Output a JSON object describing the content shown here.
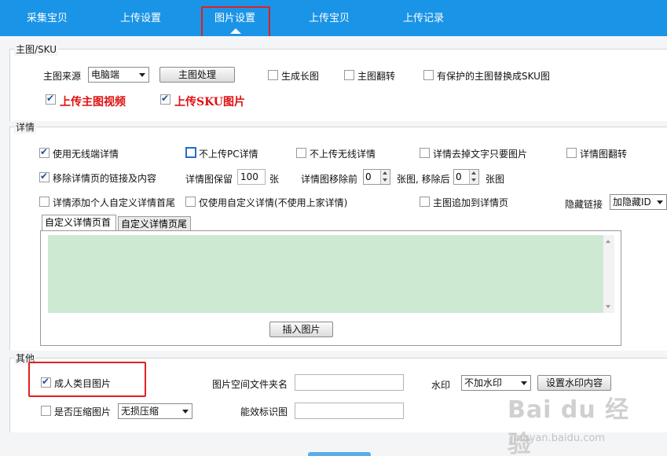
{
  "nav": {
    "tabs": [
      "采集宝贝",
      "上传设置",
      "图片设置",
      "上传宝贝",
      "上传记录"
    ],
    "active": "图片设置"
  },
  "main_image": {
    "legend": "主图/SKU",
    "source_label": "主图来源",
    "source_value": "电脑端",
    "process_button": "主图处理",
    "gen_long": "生成长图",
    "flip": "主图翻转",
    "protected": "有保护的主图替换成SKU图",
    "upload_video": "上传主图视频",
    "upload_sku": "上传SKU图片"
  },
  "detail": {
    "legend": "详情",
    "use_wireless": "使用无线端详情",
    "no_pc": "不上传PC详情",
    "no_wireless": "不上传无线详情",
    "strip_text": "详情去掉文字只要图片",
    "flip": "详情图翻转",
    "remove_links": "移除详情页的链接及内容",
    "keep_label": "详情图保留",
    "keep_value": "100",
    "keep_unit": "张",
    "remove_before_label": "详情图移除前",
    "remove_before_value": "0",
    "remove_after_label": "张图, 移除后",
    "remove_after_value": "0",
    "remove_after_unit": "张图",
    "add_custom": "详情添加个人自定义详情首尾",
    "only_custom": "仅使用自定义详情(不使用上家详情)",
    "main_to_detail": "主图追加到详情页",
    "hidden_link_label": "隐藏链接",
    "hidden_link_value": "加隐藏ID",
    "subtabs": [
      "自定义详情页首",
      "自定义详情页尾"
    ],
    "insert_button": "插入图片"
  },
  "other": {
    "legend": "其他",
    "adult": "成人类目图片",
    "folder_label": "图片空间文件夹名",
    "folder_value": "",
    "watermark_label": "水印",
    "watermark_value": "不加水印",
    "watermark_button": "设置水印内容",
    "compress": "是否压缩图片",
    "compress_value": "无损压缩",
    "efficacy_label": "能效标识图",
    "efficacy_value": ""
  },
  "watermark_overlay": {
    "logo": "Bai du 经验",
    "url": "jingyan.baidu.com"
  },
  "colors": {
    "nav_bg": "#1a94e6",
    "annotation": "#e02020",
    "editor_bg": "#cde9d2",
    "red_text": "#e01010"
  }
}
